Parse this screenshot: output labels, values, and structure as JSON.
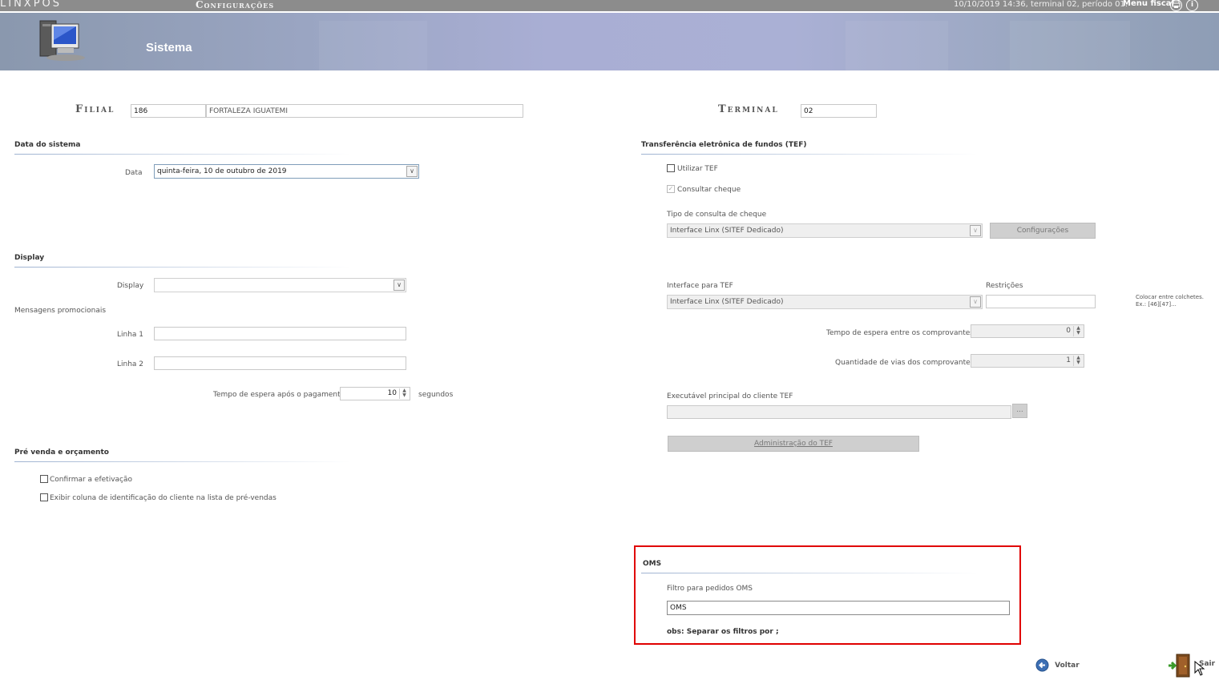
{
  "topbar": {
    "logo": "LINXPOS",
    "module": "Configurações",
    "status": "10/10/2019 14:36, terminal 02, período 01.",
    "menu_fiscal": "Menu fiscal",
    "icons": [
      "printer-icon",
      "info-icon"
    ]
  },
  "header": {
    "title": "Sistema",
    "icon": "computer-icon"
  },
  "filial": {
    "label": "Filial",
    "code": "186",
    "name": "FORTALEZA IGUATEMI"
  },
  "terminal": {
    "label": "Terminal",
    "value": "02"
  },
  "data_sistema": {
    "title": "Data do sistema",
    "data_label": "Data",
    "data_value": "quinta-feira, 10 de outubro de 2019"
  },
  "display": {
    "title": "Display",
    "display_label": "Display",
    "display_value": "",
    "mensagens_label": "Mensagens promocionais",
    "linha1_label": "Linha 1",
    "linha1_value": "",
    "linha2_label": "Linha 2",
    "linha2_value": "",
    "tempo_label": "Tempo de espera após o pagamento",
    "tempo_value": "10",
    "tempo_unit": "segundos"
  },
  "pre_venda": {
    "title": "Pré venda e orçamento",
    "confirmar_label": "Confirmar a efetivação",
    "confirmar_checked": false,
    "exibir_label": "Exibir coluna de identificação do cliente na lista de pré-vendas",
    "exibir_checked": false
  },
  "tef": {
    "title": "Transferência eletrônica de fundos (TEF)",
    "utilizar_label": "Utilizar TEF",
    "utilizar_checked": false,
    "consultar_label": "Consultar cheque",
    "consultar_checked": true,
    "tipo_consulta_label": "Tipo de consulta de cheque",
    "tipo_consulta_value": "Interface Linx (SITEF Dedicado)",
    "configuracoes_button": "Configurações",
    "interface_label": "Interface para TEF",
    "interface_value": "Interface Linx (SITEF Dedicado)",
    "restricoes_label": "Restrições",
    "restricoes_value": "",
    "restricoes_hint1": "Colocar entre colchetes.",
    "restricoes_hint2": "Ex.: [46][47]...",
    "tempo_espera_label": "Tempo de espera entre os comprovantes",
    "tempo_espera_value": "0",
    "qtd_vias_label": "Quantidade de vias dos comprovantes",
    "qtd_vias_value": "1",
    "executavel_label": "Executável principal do cliente TEF",
    "executavel_value": "",
    "browse_button": "...",
    "admin_button": "Administração do TEF"
  },
  "oms": {
    "title": "OMS",
    "filtro_label": "Filtro para pedidos OMS",
    "filtro_value": "OMS",
    "obs": "obs: Separar os filtros por ;"
  },
  "footer": {
    "voltar": "Voltar",
    "sair": "Sair"
  }
}
